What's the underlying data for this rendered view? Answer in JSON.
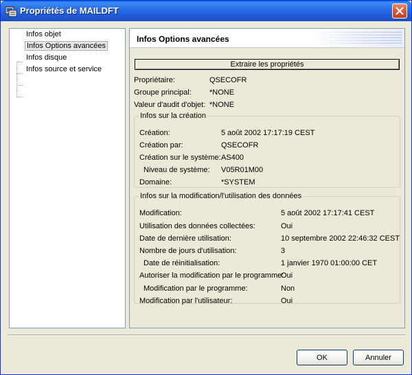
{
  "window": {
    "title": "Propriétés de MAILDFT"
  },
  "tree": {
    "items": [
      {
        "label": "Infos objet"
      },
      {
        "label": "Infos Options avancées"
      },
      {
        "label": "Infos disque"
      },
      {
        "label": "Infos source et service"
      }
    ],
    "selected": "Infos Options avancées"
  },
  "panel": {
    "title": "Infos Options avancées",
    "extract_label": "Extraire les propriétés",
    "top_fields": [
      {
        "label": "Propriétaire:",
        "value": "QSECOFR"
      },
      {
        "label": "Groupe principal:",
        "value": "*NONE"
      },
      {
        "label": "Valeur d'audit d'objet:",
        "value": "*NONE"
      }
    ],
    "creation": {
      "legend": "Infos sur la création",
      "fields": [
        {
          "label": "Création:",
          "value": "5 août 2002 17:17:19 CEST"
        },
        {
          "label": "Création par:",
          "value": "QSECOFR"
        },
        {
          "label": "Création sur le système:",
          "value": "AS400"
        },
        {
          "label": "Niveau de système:",
          "value": "V05R01M00"
        },
        {
          "label": "Domaine:",
          "value": "*SYSTEM"
        }
      ]
    },
    "modification": {
      "legend": "Infos sur la modification/l'utilisation des données",
      "fields": [
        {
          "label": "Modification:",
          "value": "5 août 2002 17:17:41 CEST"
        },
        {
          "label": "Utilisation des données collectées:",
          "value": "Oui"
        },
        {
          "label": "Date de dernière utilisation:",
          "value": "10 septembre 2002 22:46:32 CEST"
        },
        {
          "label": "Nombre de jours d'utilisation:",
          "value": "3"
        },
        {
          "label": "Date de réinitialisation:",
          "value": "1 janvier 1970 01:00:00 CET"
        },
        {
          "label": "Autoriser la modification par le programme:",
          "value": "Oui"
        },
        {
          "label": "Modification par le programme:",
          "value": "Non"
        },
        {
          "label": "Modification par l'utilisateur:",
          "value": "Oui"
        }
      ]
    }
  },
  "buttons": {
    "ok": "OK",
    "cancel": "Annuler"
  },
  "colors": {
    "titlebar": "#2b6fe8",
    "close": "#d45a3a",
    "face": "#ece9d8"
  }
}
